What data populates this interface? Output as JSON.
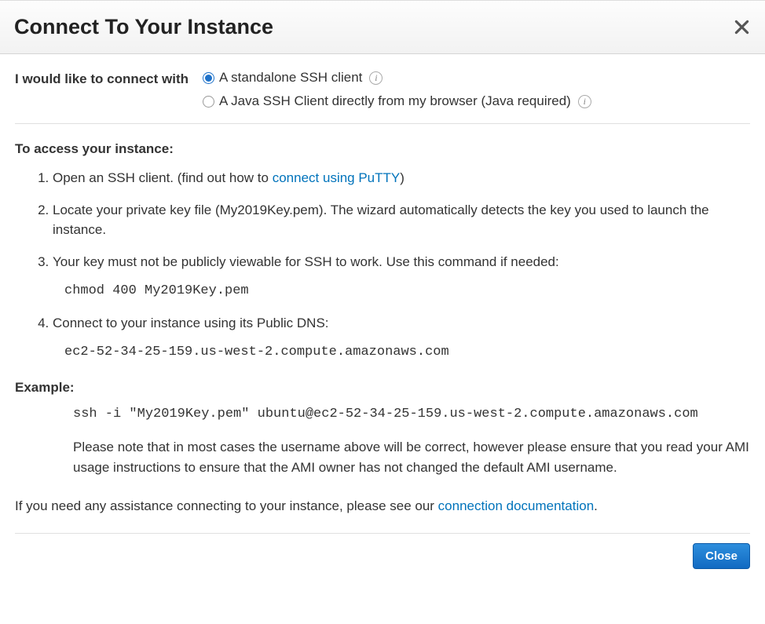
{
  "header": {
    "title": "Connect To Your Instance"
  },
  "connect": {
    "label": "I would like to connect with",
    "options": [
      {
        "label": "A standalone SSH client",
        "selected": true
      },
      {
        "label": "A Java SSH Client directly from my browser (Java required)",
        "selected": false
      }
    ]
  },
  "access": {
    "heading": "To access your instance:",
    "step1_a": "Open an SSH client. (find out how to ",
    "step1_link": "connect using PuTTY",
    "step1_b": ")",
    "step2": "Locate your private key file (My2019Key.pem). The wizard automatically detects the key you used to launch the instance.",
    "step3": "Your key must not be publicly viewable for SSH to work. Use this command if needed:",
    "step3_cmd": "chmod 400 My2019Key.pem",
    "step4": "Connect to your instance using its Public DNS:",
    "step4_dns": "ec2-52-34-25-159.us-west-2.compute.amazonaws.com"
  },
  "example": {
    "heading": "Example:",
    "command": "ssh -i \"My2019Key.pem\" ubuntu@ec2-52-34-25-159.us-west-2.compute.amazonaws.com",
    "note": "Please note that in most cases the username above will be correct, however please ensure that you read your AMI usage instructions to ensure that the AMI owner has not changed the default AMI username."
  },
  "assistance": {
    "prefix": "If you need any assistance connecting to your instance, please see our ",
    "link": "connection documentation",
    "suffix": "."
  },
  "footer": {
    "close": "Close"
  }
}
